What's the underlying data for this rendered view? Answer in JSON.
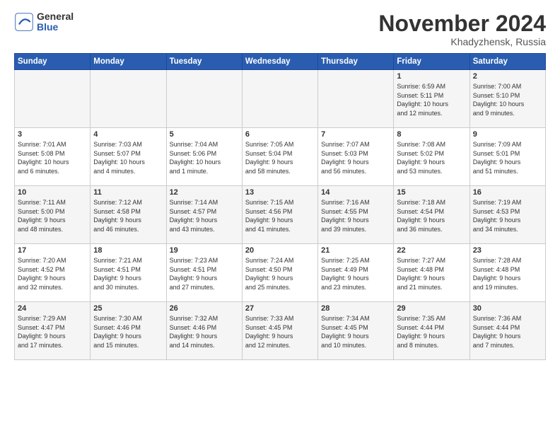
{
  "logo": {
    "general": "General",
    "blue": "Blue"
  },
  "header": {
    "month": "November 2024",
    "location": "Khadyzhensk, Russia"
  },
  "weekdays": [
    "Sunday",
    "Monday",
    "Tuesday",
    "Wednesday",
    "Thursday",
    "Friday",
    "Saturday"
  ],
  "weeks": [
    [
      {
        "day": "",
        "info": ""
      },
      {
        "day": "",
        "info": ""
      },
      {
        "day": "",
        "info": ""
      },
      {
        "day": "",
        "info": ""
      },
      {
        "day": "",
        "info": ""
      },
      {
        "day": "1",
        "info": "Sunrise: 6:59 AM\nSunset: 5:11 PM\nDaylight: 10 hours\nand 12 minutes."
      },
      {
        "day": "2",
        "info": "Sunrise: 7:00 AM\nSunset: 5:10 PM\nDaylight: 10 hours\nand 9 minutes."
      }
    ],
    [
      {
        "day": "3",
        "info": "Sunrise: 7:01 AM\nSunset: 5:08 PM\nDaylight: 10 hours\nand 6 minutes."
      },
      {
        "day": "4",
        "info": "Sunrise: 7:03 AM\nSunset: 5:07 PM\nDaylight: 10 hours\nand 4 minutes."
      },
      {
        "day": "5",
        "info": "Sunrise: 7:04 AM\nSunset: 5:06 PM\nDaylight: 10 hours\nand 1 minute."
      },
      {
        "day": "6",
        "info": "Sunrise: 7:05 AM\nSunset: 5:04 PM\nDaylight: 9 hours\nand 58 minutes."
      },
      {
        "day": "7",
        "info": "Sunrise: 7:07 AM\nSunset: 5:03 PM\nDaylight: 9 hours\nand 56 minutes."
      },
      {
        "day": "8",
        "info": "Sunrise: 7:08 AM\nSunset: 5:02 PM\nDaylight: 9 hours\nand 53 minutes."
      },
      {
        "day": "9",
        "info": "Sunrise: 7:09 AM\nSunset: 5:01 PM\nDaylight: 9 hours\nand 51 minutes."
      }
    ],
    [
      {
        "day": "10",
        "info": "Sunrise: 7:11 AM\nSunset: 5:00 PM\nDaylight: 9 hours\nand 48 minutes."
      },
      {
        "day": "11",
        "info": "Sunrise: 7:12 AM\nSunset: 4:58 PM\nDaylight: 9 hours\nand 46 minutes."
      },
      {
        "day": "12",
        "info": "Sunrise: 7:14 AM\nSunset: 4:57 PM\nDaylight: 9 hours\nand 43 minutes."
      },
      {
        "day": "13",
        "info": "Sunrise: 7:15 AM\nSunset: 4:56 PM\nDaylight: 9 hours\nand 41 minutes."
      },
      {
        "day": "14",
        "info": "Sunrise: 7:16 AM\nSunset: 4:55 PM\nDaylight: 9 hours\nand 39 minutes."
      },
      {
        "day": "15",
        "info": "Sunrise: 7:18 AM\nSunset: 4:54 PM\nDaylight: 9 hours\nand 36 minutes."
      },
      {
        "day": "16",
        "info": "Sunrise: 7:19 AM\nSunset: 4:53 PM\nDaylight: 9 hours\nand 34 minutes."
      }
    ],
    [
      {
        "day": "17",
        "info": "Sunrise: 7:20 AM\nSunset: 4:52 PM\nDaylight: 9 hours\nand 32 minutes."
      },
      {
        "day": "18",
        "info": "Sunrise: 7:21 AM\nSunset: 4:51 PM\nDaylight: 9 hours\nand 30 minutes."
      },
      {
        "day": "19",
        "info": "Sunrise: 7:23 AM\nSunset: 4:51 PM\nDaylight: 9 hours\nand 27 minutes."
      },
      {
        "day": "20",
        "info": "Sunrise: 7:24 AM\nSunset: 4:50 PM\nDaylight: 9 hours\nand 25 minutes."
      },
      {
        "day": "21",
        "info": "Sunrise: 7:25 AM\nSunset: 4:49 PM\nDaylight: 9 hours\nand 23 minutes."
      },
      {
        "day": "22",
        "info": "Sunrise: 7:27 AM\nSunset: 4:48 PM\nDaylight: 9 hours\nand 21 minutes."
      },
      {
        "day": "23",
        "info": "Sunrise: 7:28 AM\nSunset: 4:48 PM\nDaylight: 9 hours\nand 19 minutes."
      }
    ],
    [
      {
        "day": "24",
        "info": "Sunrise: 7:29 AM\nSunset: 4:47 PM\nDaylight: 9 hours\nand 17 minutes."
      },
      {
        "day": "25",
        "info": "Sunrise: 7:30 AM\nSunset: 4:46 PM\nDaylight: 9 hours\nand 15 minutes."
      },
      {
        "day": "26",
        "info": "Sunrise: 7:32 AM\nSunset: 4:46 PM\nDaylight: 9 hours\nand 14 minutes."
      },
      {
        "day": "27",
        "info": "Sunrise: 7:33 AM\nSunset: 4:45 PM\nDaylight: 9 hours\nand 12 minutes."
      },
      {
        "day": "28",
        "info": "Sunrise: 7:34 AM\nSunset: 4:45 PM\nDaylight: 9 hours\nand 10 minutes."
      },
      {
        "day": "29",
        "info": "Sunrise: 7:35 AM\nSunset: 4:44 PM\nDaylight: 9 hours\nand 8 minutes."
      },
      {
        "day": "30",
        "info": "Sunrise: 7:36 AM\nSunset: 4:44 PM\nDaylight: 9 hours\nand 7 minutes."
      }
    ]
  ]
}
